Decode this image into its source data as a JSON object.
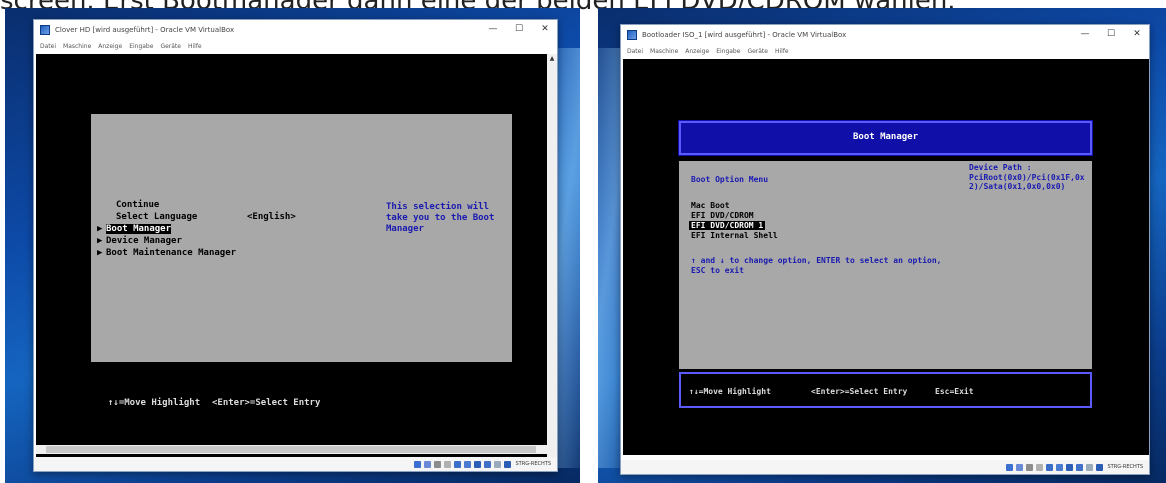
{
  "caption": "screen. Erst Bootmanager dann eine der beiden EFI DVD/CDROM wählen.",
  "menu_labels": [
    "Datei",
    "Maschine",
    "Anzeige",
    "Eingabe",
    "Geräte",
    "Hilfe"
  ],
  "host_key": "STRG-RECHTS",
  "left_window": {
    "title": "Clover HD [wird ausgeführt] - Oracle VM VirtualBox",
    "boot": {
      "items": [
        {
          "label": "Continue",
          "arrow": "",
          "selected": false
        },
        {
          "label": "Select Language",
          "arrow": "",
          "selected": false
        },
        {
          "label": "Boot Manager",
          "arrow": "▶",
          "selected": true
        },
        {
          "label": "Device Manager",
          "arrow": "▶",
          "selected": false
        },
        {
          "label": "Boot Maintenance Manager",
          "arrow": "▶",
          "selected": false
        }
      ],
      "language_value": "<English>",
      "help_text": "This selection will take you to the Boot Manager",
      "footer_move": "↑↓=Move Highlight",
      "footer_select": "<Enter>=Select Entry"
    }
  },
  "right_window": {
    "title": "Bootloader ISO_1 [wird ausgeführt] - Oracle VM VirtualBox",
    "boot": {
      "header": "Boot Manager",
      "menu_title": "Boot Option Menu",
      "device_path_label": "Device Path :",
      "device_path_value": "PciRoot(0x0)/Pci(0x1F,0x2)/Sata(0x1,0x0,0x0)",
      "options": [
        {
          "label": "Mac Boot",
          "selected": false
        },
        {
          "label": "EFI DVD/CDROM",
          "selected": false
        },
        {
          "label": "EFI DVD/CDROM 1",
          "selected": true
        },
        {
          "label": "EFI Internal Shell",
          "selected": false
        }
      ],
      "help_line1": "↑ and ↓ to change option, ENTER to select an option,",
      "help_line2": "ESC to exit",
      "footer_move": "↑↓=Move Highlight",
      "footer_select": "<Enter>=Select Entry",
      "footer_exit": "Esc=Exit"
    }
  },
  "colors": {
    "bios_gray": "#a8a8a8",
    "bios_blue": "#1010a8",
    "help_blue": "#1a1ab0"
  }
}
